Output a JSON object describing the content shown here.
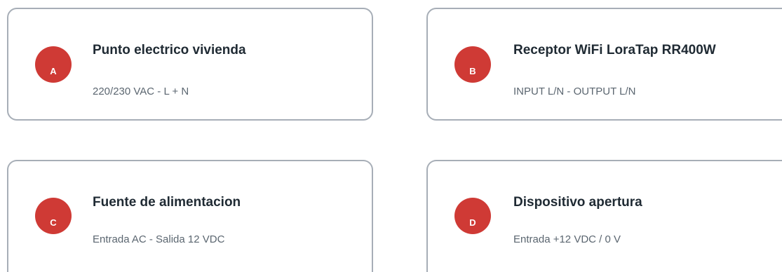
{
  "cards": [
    {
      "badge": "A",
      "title": "Punto electrico vivienda",
      "subtitle": "220/230 VAC - L + N"
    },
    {
      "badge": "B",
      "title": "Receptor WiFi LoraTap RR400W",
      "subtitle": "INPUT L/N - OUTPUT L/N"
    },
    {
      "badge": "C",
      "title": "Fuente de alimentacion",
      "subtitle": "Entrada AC - Salida 12 VDC"
    },
    {
      "badge": "D",
      "title": "Dispositivo apertura",
      "subtitle": "Entrada +12 VDC / 0 V"
    }
  ],
  "colors": {
    "badge_fill": "#cf3a35",
    "card_border": "#a7aeb7",
    "title_text": "#1f2a33",
    "subtitle_text": "#5b6670"
  }
}
